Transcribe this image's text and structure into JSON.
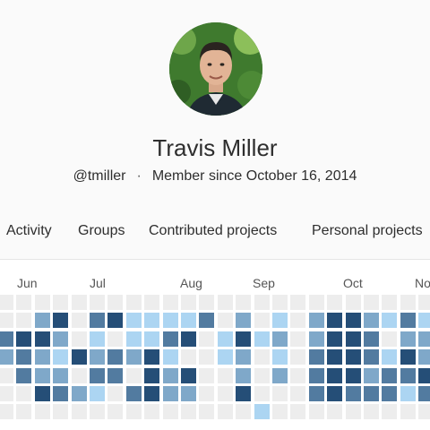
{
  "profile": {
    "name": "Travis Miller",
    "username": "@tmiller",
    "separator": "·",
    "member_since": "Member since October 16, 2014"
  },
  "tabs": [
    {
      "label": "Activity"
    },
    {
      "label": "Groups"
    },
    {
      "label": "Contributed projects"
    },
    {
      "label": "Personal projects"
    }
  ],
  "calendar": {
    "months": [
      "Jun",
      "Jul",
      "Aug",
      "Sep",
      "Oct",
      "No"
    ],
    "palette": [
      "#ededed",
      "#acd5f2",
      "#7fa8c9",
      "#527ba0",
      "#254e77"
    ],
    "levels": [
      [
        0,
        0,
        3,
        2,
        0,
        0,
        0
      ],
      [
        0,
        0,
        4,
        3,
        3,
        0,
        0
      ],
      [
        0,
        2,
        4,
        2,
        2,
        4,
        0
      ],
      [
        0,
        4,
        2,
        1,
        2,
        3,
        0
      ],
      [
        0,
        0,
        0,
        4,
        0,
        2,
        0
      ],
      [
        0,
        3,
        1,
        2,
        3,
        1,
        0
      ],
      [
        0,
        4,
        0,
        3,
        3,
        0,
        0
      ],
      [
        0,
        1,
        1,
        2,
        0,
        3,
        0
      ],
      [
        0,
        1,
        1,
        4,
        4,
        4,
        0
      ],
      [
        0,
        1,
        3,
        1,
        2,
        2,
        0
      ],
      [
        0,
        1,
        4,
        0,
        4,
        2,
        0
      ],
      [
        0,
        3,
        0,
        0,
        0,
        0,
        0
      ],
      [
        0,
        0,
        1,
        1,
        0,
        0,
        0
      ],
      [
        0,
        2,
        4,
        2,
        2,
        4,
        0
      ],
      [
        0,
        0,
        1,
        0,
        0,
        0,
        1
      ],
      [
        0,
        1,
        2,
        1,
        2,
        0,
        0
      ],
      [
        0,
        0,
        0,
        0,
        0,
        0,
        0
      ],
      [
        0,
        2,
        2,
        3,
        3,
        3,
        0
      ],
      [
        0,
        4,
        4,
        4,
        4,
        4,
        0
      ],
      [
        0,
        4,
        4,
        4,
        4,
        3,
        0
      ],
      [
        0,
        2,
        3,
        3,
        2,
        3,
        0
      ],
      [
        0,
        1,
        0,
        1,
        3,
        3,
        0
      ],
      [
        0,
        3,
        2,
        4,
        3,
        1,
        0
      ],
      [
        0,
        1,
        2,
        2,
        4,
        3,
        0
      ]
    ]
  }
}
